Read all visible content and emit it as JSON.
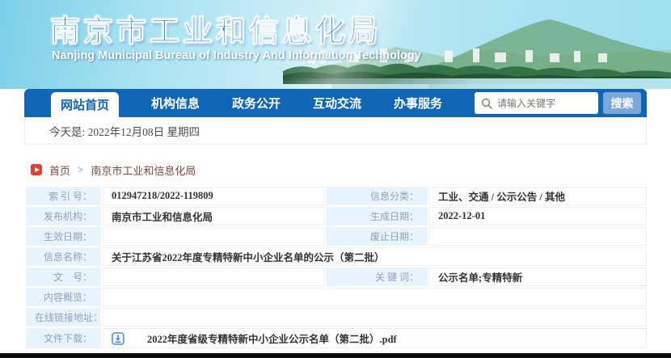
{
  "banner": {
    "title": "南京市工业和信息化局",
    "subtitle": "Nanjing Municipal Bureau of Industry And Information Technology"
  },
  "nav": {
    "tabs": [
      {
        "label": "网站首页",
        "active": true
      },
      {
        "label": "机构信息",
        "active": false
      },
      {
        "label": "政务公开",
        "active": false
      },
      {
        "label": "互动交流",
        "active": false
      },
      {
        "label": "办事服务",
        "active": false
      }
    ],
    "search": {
      "placeholder": "请输入关键字",
      "button_label": "搜索"
    }
  },
  "date_bar": {
    "text": "今天是: 2022年12月08日 星期四"
  },
  "breadcrumb": {
    "home": "首页",
    "separator": ">",
    "current": "南京市工业和信息化局"
  },
  "info_table": {
    "index_label": "索 引 号：",
    "index_value": "012947218/2022-119809",
    "category_label": "信息分类：",
    "category_value": "工业、交通 / 公示公告 / 其他",
    "publisher_label": "发布机构：",
    "publisher_value": "南京市工业和信息化局",
    "created_label": "生成日期：",
    "created_value": "2022-12-01",
    "effective_label": "生效日期：",
    "effective_value": "",
    "expiry_label": "废止日期：",
    "expiry_value": "",
    "name_label": "信息名称：",
    "name_value": "关于江苏省2022年度专精特新中小企业名单的公示（第二批）",
    "docnum_label": "文　号：",
    "docnum_value": "",
    "keywords_label": "关 键 词：",
    "keywords_value": "公示名单;专精特新",
    "summary_label": "内容概览：",
    "summary_value": "",
    "link_label": "在线链接地址：",
    "link_value": "",
    "download_label": "文件下载：",
    "download_file": "2022年度省级专精特新中小企业公示名单（第二批）.pdf"
  },
  "icons": {
    "search": "magnifier-icon",
    "breadcrumb": "play-icon",
    "download": "download-icon"
  },
  "colors": {
    "nav_blue": "#1065b5",
    "label_cell_bg": "#e9f3fb",
    "search_button_blue": "#7aa6d8",
    "breadcrumb_icon_red": "#e23d35",
    "download_icon_blue": "#4a8fdc",
    "banner_title_blue": "#1e74c8"
  }
}
